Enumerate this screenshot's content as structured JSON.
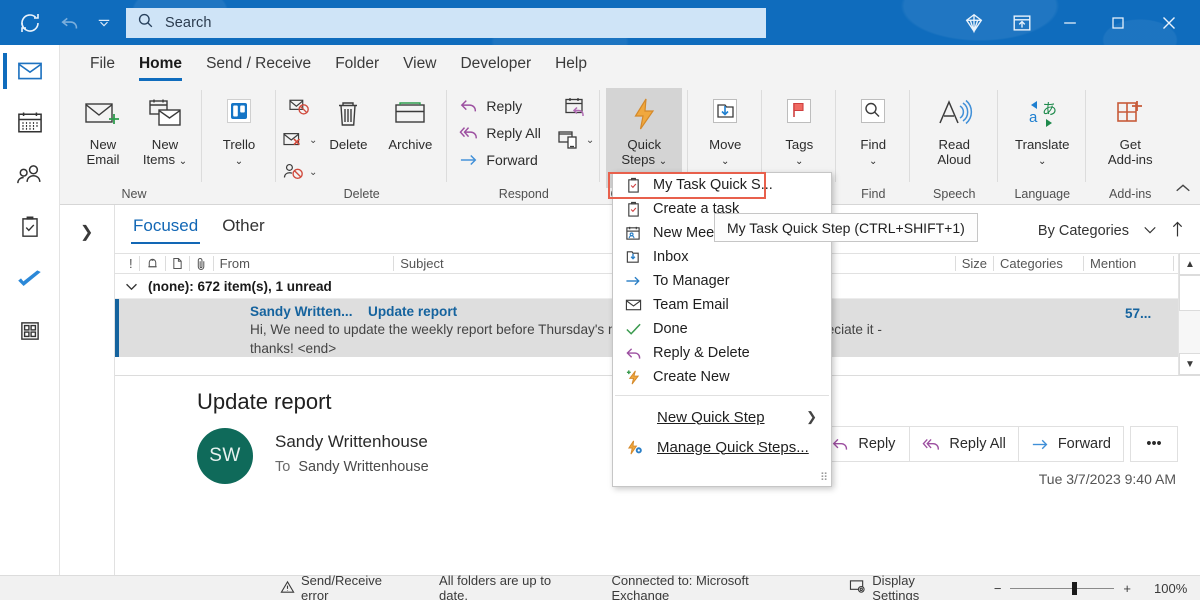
{
  "titlebar": {
    "search_placeholder": "Search",
    "icons": [
      "sync-icon",
      "undo-icon",
      "chevron-down-icon",
      "diamond-icon",
      "present-icon",
      "minimize-icon",
      "maximize-icon",
      "close-icon"
    ]
  },
  "rail": {
    "items": [
      {
        "name": "mail",
        "label": "Mail",
        "active": true
      },
      {
        "name": "calendar",
        "label": "Calendar",
        "active": false
      },
      {
        "name": "people",
        "label": "People",
        "active": false
      },
      {
        "name": "tasks",
        "label": "Tasks",
        "active": false
      },
      {
        "name": "todo",
        "label": "To Do",
        "active": false
      },
      {
        "name": "more-apps",
        "label": "More apps",
        "active": false
      }
    ]
  },
  "ribbon": {
    "tabs": [
      {
        "label": "File",
        "active": false
      },
      {
        "label": "Home",
        "active": true
      },
      {
        "label": "Send / Receive",
        "active": false
      },
      {
        "label": "Folder",
        "active": false
      },
      {
        "label": "View",
        "active": false
      },
      {
        "label": "Developer",
        "active": false
      },
      {
        "label": "Help",
        "active": false
      }
    ],
    "groups": [
      {
        "label": "New",
        "buttons": [
          {
            "label_line1": "New",
            "label_line2": "Email",
            "icon": "new-email-icon",
            "has_chevron": false
          },
          {
            "label_line1": "New",
            "label_line2": "Items",
            "icon": "new-items-icon",
            "has_chevron": true
          }
        ]
      },
      {
        "label": "",
        "buttons": [
          {
            "label_line1": "Trello",
            "label_line2": "",
            "icon": "trello-icon",
            "has_chevron": true
          }
        ]
      },
      {
        "label": "Delete",
        "buttons": [
          {
            "label_line1": "Delete",
            "label_line2": "",
            "icon": "delete-icon",
            "has_chevron": false
          },
          {
            "label_line1": "Archive",
            "label_line2": "",
            "icon": "archive-icon",
            "has_chevron": false
          }
        ],
        "small_icons": [
          "ignore-icon",
          "junk-icon",
          "block-sender-icon"
        ]
      },
      {
        "label": "Respond",
        "commands": [
          {
            "label": "Reply",
            "icon": "reply-icon"
          },
          {
            "label": "Reply All",
            "icon": "reply-all-icon"
          },
          {
            "label": "Forward",
            "icon": "forward-icon"
          }
        ],
        "small_icons": [
          "meeting-icon",
          "more-respond-icon"
        ]
      },
      {
        "label": "Quick Steps",
        "buttons": [
          {
            "label_line1": "Quick",
            "label_line2": "Steps",
            "icon": "quick-steps-icon",
            "has_chevron": true,
            "pressed": true
          }
        ]
      },
      {
        "label": "Move",
        "buttons": [
          {
            "label_line1": "Move",
            "label_line2": "",
            "icon": "move-icon",
            "has_chevron": true
          }
        ]
      },
      {
        "label": "Tags",
        "buttons": [
          {
            "label_line1": "Tags",
            "label_line2": "",
            "icon": "tags-icon",
            "has_chevron": true
          }
        ]
      },
      {
        "label": "Find",
        "buttons": [
          {
            "label_line1": "Find",
            "label_line2": "",
            "icon": "find-icon",
            "has_chevron": true
          }
        ]
      },
      {
        "label": "Speech",
        "buttons": [
          {
            "label_line1": "Read",
            "label_line2": "Aloud",
            "icon": "read-aloud-icon",
            "has_chevron": false
          }
        ]
      },
      {
        "label": "Language",
        "buttons": [
          {
            "label_line1": "Translate",
            "label_line2": "",
            "icon": "translate-icon",
            "has_chevron": true
          }
        ]
      },
      {
        "label": "Add-ins",
        "buttons": [
          {
            "label_line1": "Get",
            "label_line2": "Add-ins",
            "icon": "get-addins-icon",
            "has_chevron": false
          }
        ]
      }
    ]
  },
  "quick_steps_menu": {
    "items": [
      {
        "label": "My Task Quick S...",
        "icon": "task-clipboard-icon",
        "highlighted": true
      },
      {
        "label": "Create a task",
        "icon": "create-task-icon",
        "highlighted": false
      },
      {
        "label": "New Meeting",
        "icon": "new-meeting-icon",
        "highlighted": false
      },
      {
        "label": "Inbox",
        "icon": "inbox-icon",
        "highlighted": false
      },
      {
        "label": "To Manager",
        "icon": "to-manager-icon",
        "highlighted": false
      },
      {
        "label": "Team Email",
        "icon": "team-email-icon",
        "highlighted": false
      },
      {
        "label": "Done",
        "icon": "done-check-icon",
        "highlighted": false
      },
      {
        "label": "Reply & Delete",
        "icon": "reply-delete-icon",
        "highlighted": false
      },
      {
        "label": "Create New",
        "icon": "create-new-icon",
        "highlighted": false
      }
    ],
    "footer_items": [
      {
        "label": "New Quick Step",
        "icon": "",
        "has_submenu": true,
        "underline_char": "N"
      },
      {
        "label": "Manage Quick Steps...",
        "icon": "manage-quick-steps-icon",
        "has_submenu": false,
        "underline_char": "M"
      }
    ],
    "tooltip": "My Task Quick Step (CTRL+SHIFT+1)",
    "highlight_color": "#e8604c"
  },
  "mail_list": {
    "pivots": [
      {
        "label": "Focused",
        "active": true
      },
      {
        "label": "Other",
        "active": false
      }
    ],
    "sort": {
      "label": "By Categories",
      "chevron": "chevron-down-icon",
      "direction_icon": "sort-ascending-icon"
    },
    "columns_left": [
      "!",
      "reminder-icon",
      "item-type-icon",
      "attachment-icon",
      "From",
      "Subject"
    ],
    "columns_right": [
      "Size",
      "Categories",
      "Mention",
      "flag-icon"
    ],
    "group_header": "(none): 672 item(s), 1 unread",
    "rows": [
      {
        "from": "Sandy Written...",
        "subject": "Update report",
        "preview_line1": "Hi,  We need to update the weekly report before Thursday's mee",
        "preview_line1_right": "d it out ahead of time?  Appreciate it -",
        "preview_line2": "thanks!  <end>",
        "size": "57...",
        "selected": true,
        "unread": true
      }
    ]
  },
  "reading_pane": {
    "subject": "Update report",
    "avatar_initials": "SW",
    "from": "Sandy Writtenhouse",
    "to_label": "To",
    "to": "Sandy Writtenhouse",
    "date": "Tue 3/7/2023 9:40 AM",
    "actions": [
      {
        "label": "Reply",
        "icon": "reply-icon"
      },
      {
        "label": "Reply All",
        "icon": "reply-all-icon"
      },
      {
        "label": "Forward",
        "icon": "forward-icon"
      },
      {
        "label": "•••",
        "icon": "more-actions-icon"
      }
    ]
  },
  "statusbar": {
    "error": "Send/Receive error",
    "folders": "All folders are up to date.",
    "connection": "Connected to: Microsoft Exchange",
    "display_settings": "Display Settings",
    "zoom_minus": "−",
    "zoom_plus": "+",
    "zoom_percent": "100%"
  }
}
